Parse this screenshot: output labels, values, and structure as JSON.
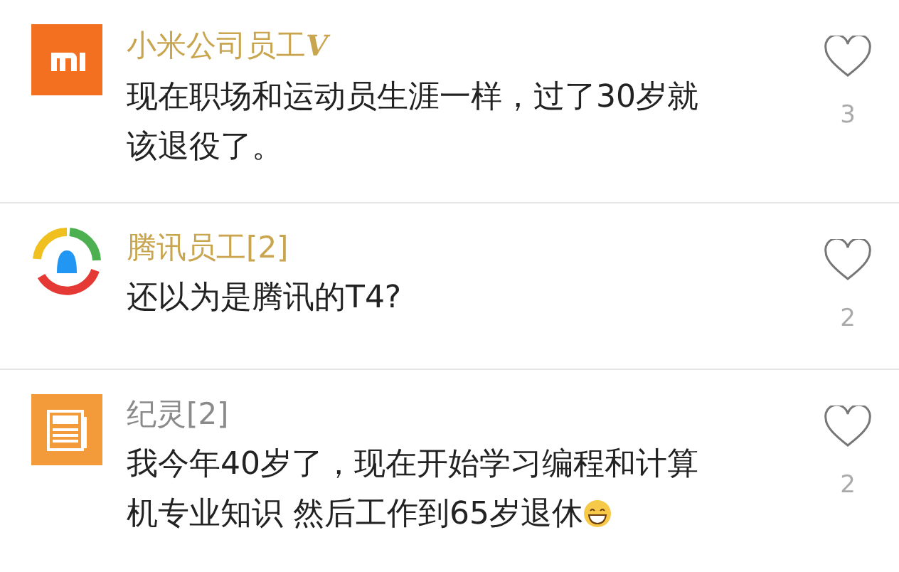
{
  "comments": [
    {
      "kind": "mi",
      "author": "小米公司员工",
      "badge": "V",
      "color": "#c8a54e",
      "lines": [
        "现在职场和运动员生涯一样，过了30岁就",
        "该退役了。"
      ],
      "likes": "3"
    },
    {
      "kind": "tencent",
      "author": "腾讯员工[2]",
      "color": "#c8a54e",
      "lines": [
        "还以为是腾讯的T4?"
      ],
      "likes": "2"
    },
    {
      "kind": "news",
      "author": "纪灵[2]",
      "color": "#8a8a8a",
      "lines": [
        "我今年40岁了，现在开始学习编程和计算",
        "机专业知识 然后工作到65岁退休"
      ],
      "has_emoji": true,
      "likes": "2"
    }
  ]
}
